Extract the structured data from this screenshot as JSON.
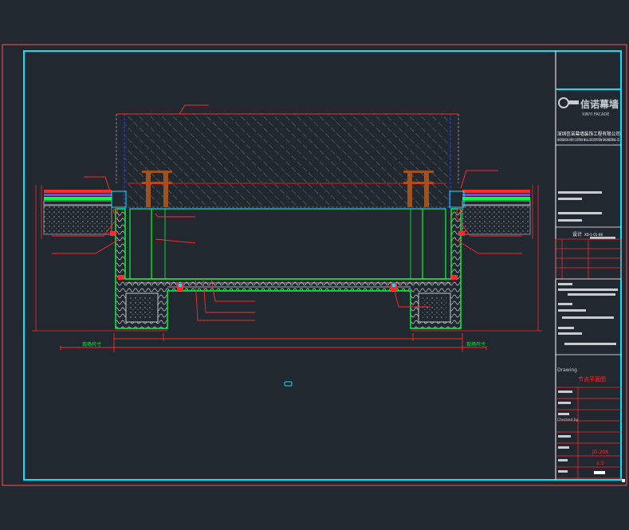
{
  "colors": {
    "background": "#212830",
    "sheet_border": "#ff5050",
    "frame": "#00e5ff",
    "hatch": "#9aa3ad",
    "profile": "#00ff3c",
    "dimension": "#ff2a2a",
    "steel": "#a0521e",
    "glass_edge": "#2a3cff",
    "white": "#ffffff",
    "yellow": "#ffff00"
  },
  "title_block": {
    "logo_text": "信诺幕墙",
    "logo_sub": "XINYI FACADE",
    "company_cn": "深圳信诺幕墙装饰工程有限公司",
    "company_en": "SHENZHEN XINYI CURTAIN WALL DECORATION ENGINEERING CO.",
    "section_drawing": "Drawing",
    "drawing_name": "节点平面图",
    "drawing_no": "JD-208",
    "scale": "1:5",
    "labels": {
      "checked": "Checked by",
      "drawing": "Drawing",
      "project": "Project",
      "date": "Date"
    },
    "block_label": "设计",
    "block_code": "XD-1-01-08"
  },
  "dimensions": {
    "left_label": "现场尺寸",
    "right_label": "现场尺寸"
  },
  "icons": {
    "logo": "company-logo-icon",
    "marker": "view-marker-icon"
  }
}
